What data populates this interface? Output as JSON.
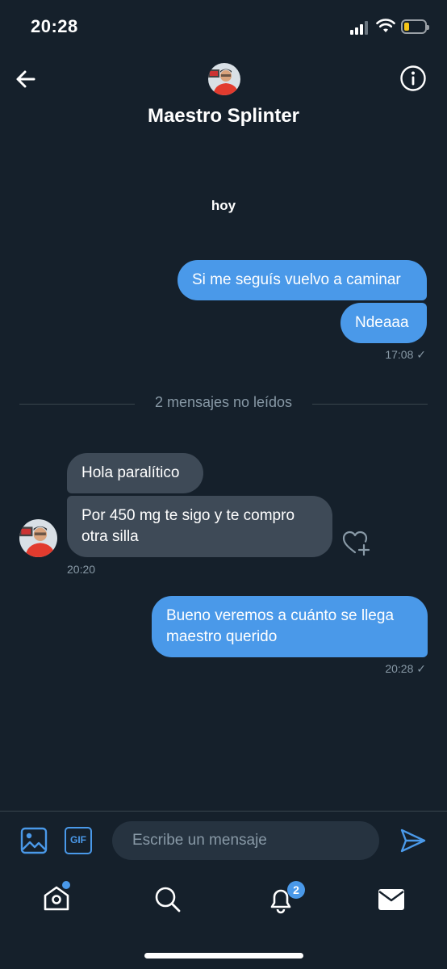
{
  "status_bar": {
    "time": "20:28"
  },
  "header": {
    "title": "Maestro Splinter",
    "icons": {
      "back": "arrow-left-icon",
      "info": "info-icon"
    }
  },
  "conversation": {
    "day_label": "hoy",
    "unread_divider": "2 mensajes no leídos",
    "messages": [
      {
        "direction": "outgoing",
        "text": "Si me seguís vuelvo a caminar"
      },
      {
        "direction": "outgoing",
        "text": "Ndeaaa",
        "time": "17:08 ✓"
      },
      {
        "direction": "incoming",
        "text": "Hola paralítico"
      },
      {
        "direction": "incoming",
        "text_line1": "Por 450 mg te sigo y te compro",
        "text_line2": "otra silla",
        "time": "20:20"
      },
      {
        "direction": "outgoing",
        "text_line1": "Bueno veremos a cuánto se llega",
        "text_line2": "maestro querido",
        "time": "20:28 ✓"
      }
    ]
  },
  "composer": {
    "placeholder": "Escribe un mensaje",
    "gif_label": "GIF"
  },
  "bottom_nav": {
    "notifications_badge": "2"
  },
  "colors": {
    "background": "#15202b",
    "accent": "#4a99e9",
    "incoming_bubble": "#3e4a57",
    "muted_text": "#8899a6"
  }
}
